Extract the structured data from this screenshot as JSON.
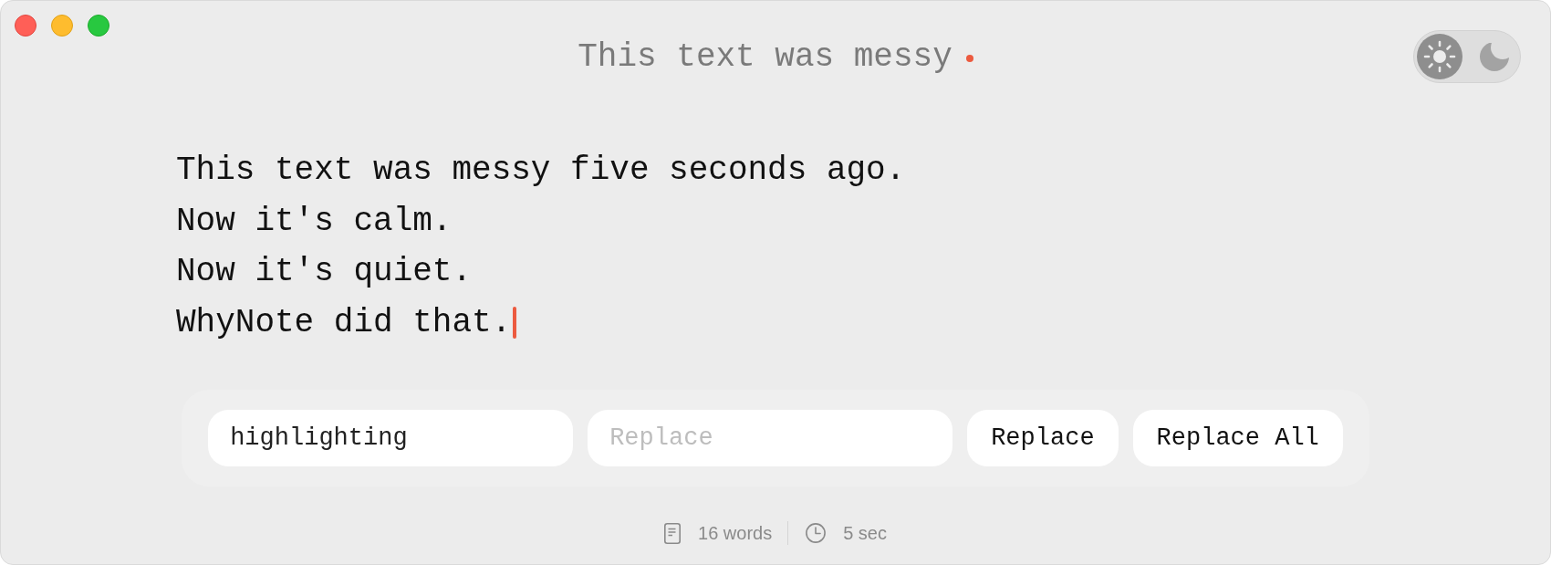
{
  "window": {
    "title": "This text was messy",
    "unsaved": true
  },
  "theme_toggle": {
    "options": [
      {
        "kind": "light",
        "selected": true
      },
      {
        "kind": "dark",
        "selected": false
      }
    ]
  },
  "editor": {
    "lines": [
      "This text was messy five seconds ago.",
      "Now it's calm.",
      "Now it's quiet.",
      "WhyNote did that."
    ],
    "caret": true
  },
  "find_bar": {
    "search": {
      "value": "highlighting"
    },
    "replace": {
      "placeholder": "Replace"
    },
    "buttons": [
      "Replace",
      "Replace All"
    ]
  },
  "status_bar": {
    "items": [
      {
        "kind": "words",
        "text": "16 words"
      },
      {
        "kind": "time",
        "text": "5 sec"
      }
    ]
  }
}
